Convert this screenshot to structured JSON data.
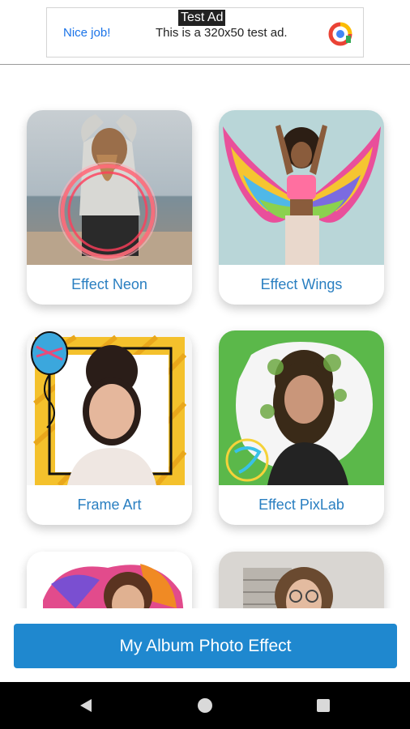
{
  "ad": {
    "label": "Test Ad",
    "left_text": "Nice job!",
    "body_text": "This is a 320x50 test ad."
  },
  "cards": [
    {
      "label": "Effect Neon",
      "icon": "neon-effect-thumbnail"
    },
    {
      "label": "Effect Wings",
      "icon": "wings-effect-thumbnail"
    },
    {
      "label": "Frame Art",
      "icon": "frame-art-thumbnail"
    },
    {
      "label": "Effect PixLab",
      "icon": "pixlab-effect-thumbnail"
    },
    {
      "label": "",
      "icon": "splash-effect-thumbnail"
    },
    {
      "label": "",
      "icon": "portrait-effect-thumbnail"
    }
  ],
  "bottom_button": {
    "label": "My Album Photo Effect"
  },
  "colors": {
    "accent": "#1f88cf",
    "card_label": "#2a7fc1",
    "nav_bg": "#000000"
  },
  "navbar": {
    "back": "back-icon",
    "home": "home-icon",
    "recents": "recents-icon"
  }
}
